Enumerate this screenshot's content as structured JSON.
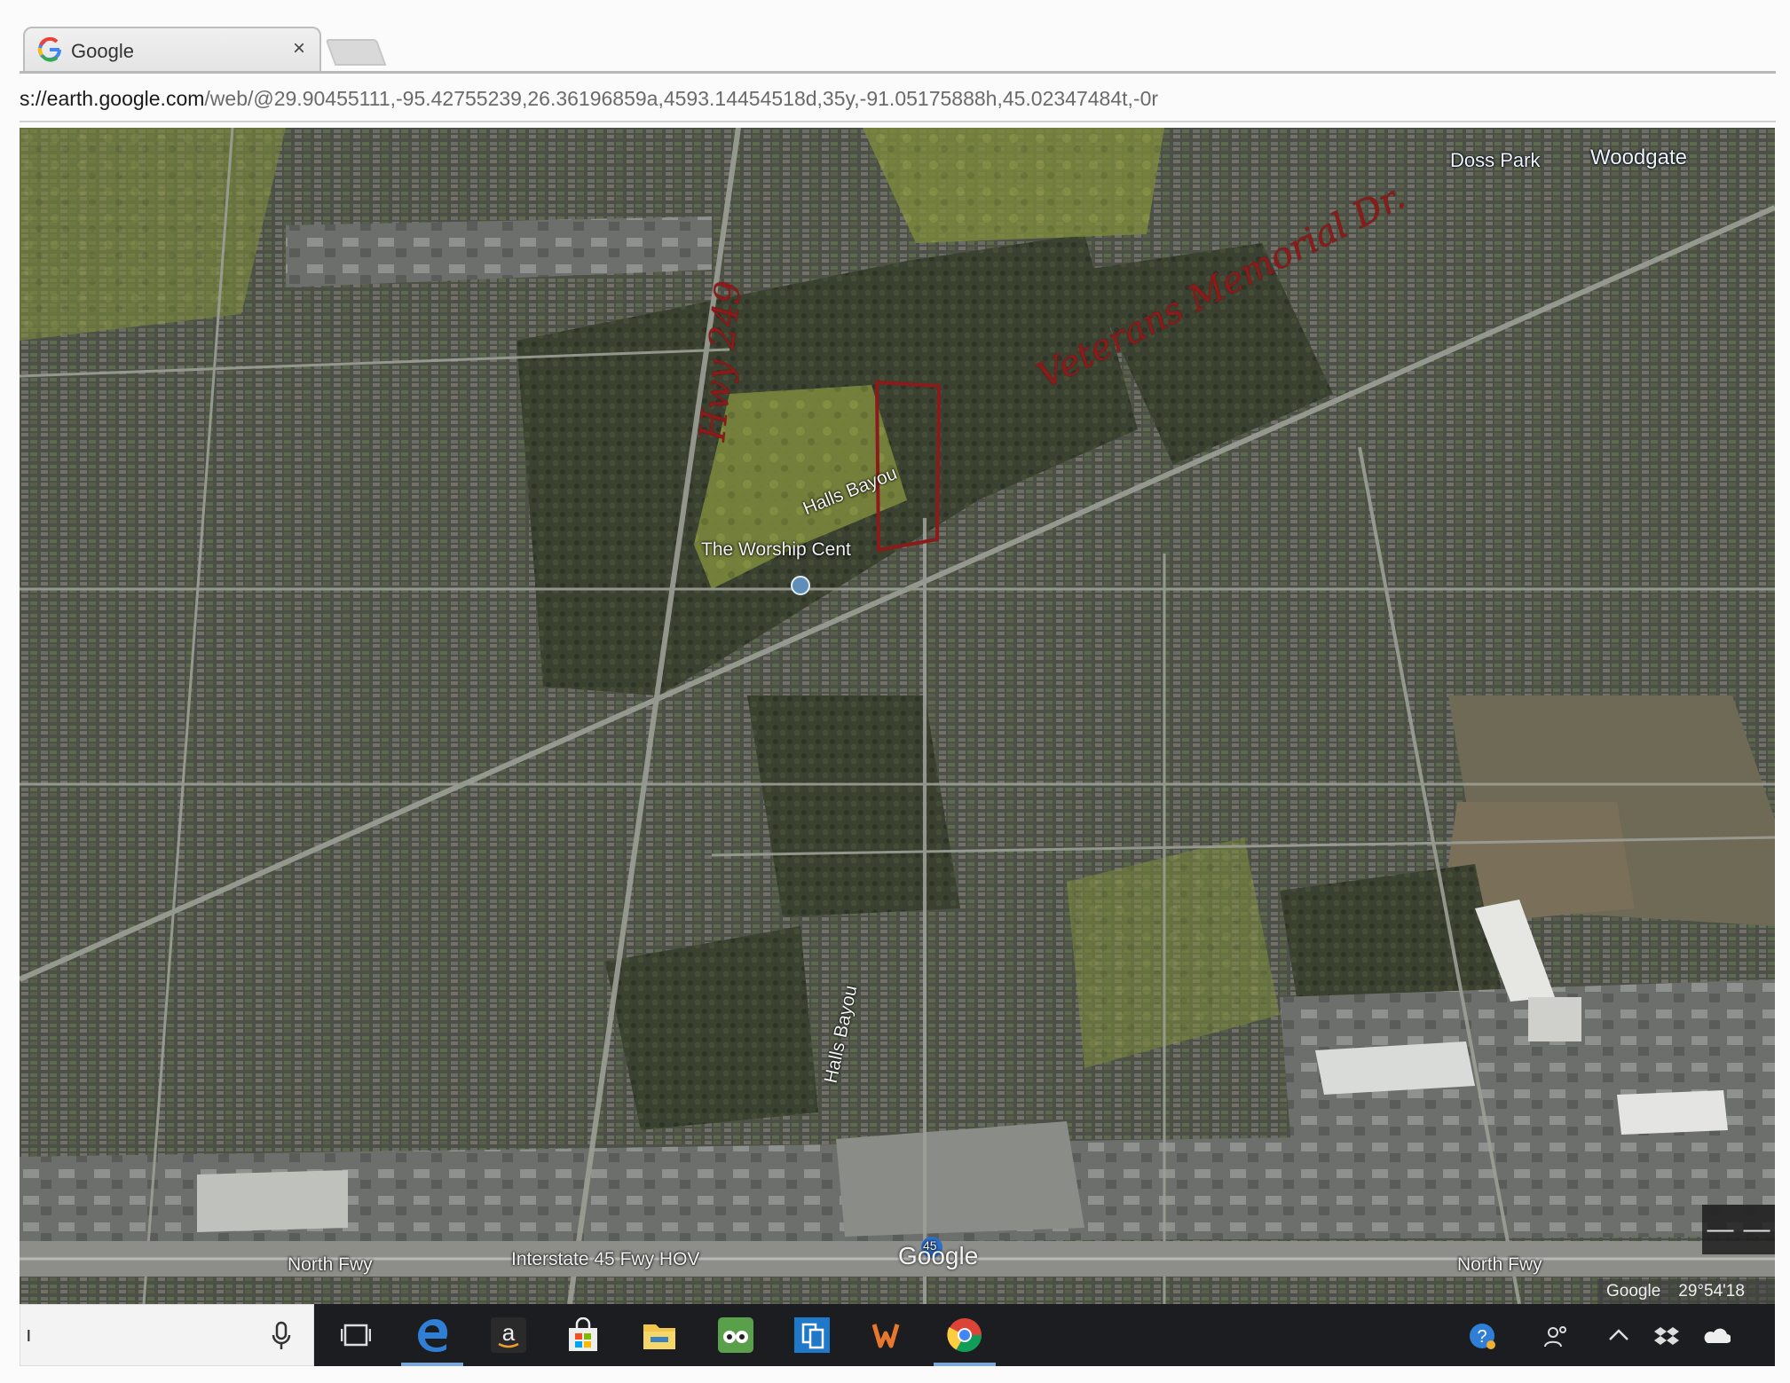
{
  "browser": {
    "tab_title": "Google",
    "tab_close": "×",
    "address_host": "s://earth.google.com",
    "address_path": "/web/@29.90455111,-95.42755239,26.36196859a,4593.14454518d,35y,-91.05175888h,45.02347484t,-0r"
  },
  "map": {
    "labels": {
      "doss_park": "Doss Park",
      "woodgate": "Woodgate",
      "halls_bayou_1": "Halls Bayou",
      "halls_bayou_2": "Halls Bayou",
      "worship_center": "The Worship Cent",
      "north_fwy_left": "North Fwy",
      "interstate": "Interstate 45 Fwy HOV",
      "north_fwy_right": "North Fwy",
      "i45_shield": "45"
    },
    "annotations": {
      "hwy": "Hwy 249",
      "veterans": "Veterans Memorial Dr."
    },
    "watermark": "Google",
    "attribution": "Google",
    "coordinate": "29°54'18",
    "zoom_minus": "—",
    "zoom_plus": "—"
  },
  "taskbar": {
    "search_text": "ı",
    "icons": [
      "task-view-icon",
      "edge-icon",
      "amazon-icon",
      "store-icon",
      "file-explorer-icon",
      "tripadvisor-icon",
      "tablet-icon",
      "office-icon",
      "chrome-icon"
    ],
    "tray": [
      "help-icon",
      "people-icon",
      "chevron-up-icon",
      "dropbox-icon",
      "onedrive-icon"
    ],
    "colors": {
      "bar": "#1c1d21",
      "active": "#7aa6d8"
    }
  }
}
